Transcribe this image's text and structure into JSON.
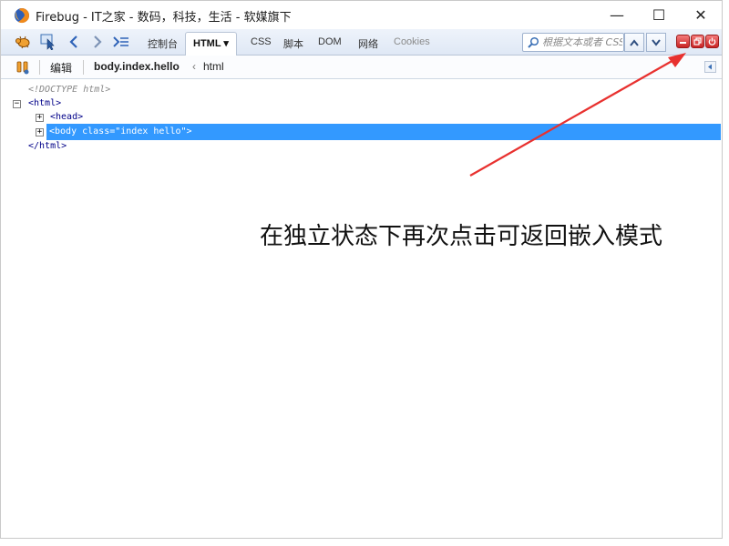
{
  "window": {
    "title": "Firebug - IT之家 - 数码，科技，生活 - 软媒旗下",
    "minimize_glyph": "—",
    "maximize_glyph": "☐",
    "close_glyph": "✕"
  },
  "tabs": [
    {
      "label": "控制台",
      "active": false,
      "disabled": false
    },
    {
      "label": "HTML ▾",
      "active": true,
      "disabled": false
    },
    {
      "label": "CSS",
      "active": false,
      "disabled": false
    },
    {
      "label": "脚本",
      "active": false,
      "disabled": false
    },
    {
      "label": "DOM",
      "active": false,
      "disabled": false
    },
    {
      "label": "网络",
      "active": false,
      "disabled": false
    },
    {
      "label": "Cookies",
      "active": false,
      "disabled": true
    }
  ],
  "search": {
    "placeholder": "根据文本或者 CSS"
  },
  "subbar": {
    "edit_label": "编辑",
    "breadcrumb_current": "body.index.hello",
    "breadcrumb_sep": "‹",
    "breadcrumb_parent": "html"
  },
  "tree": {
    "doctype": "<!DOCTYPE html>",
    "html_open": "<html>",
    "head": "<head>",
    "body": "<body class=\"index hello\">",
    "html_close": "</html>",
    "collapse_glyph": "−",
    "expand_glyph": "+"
  },
  "annotation": "在独立状态下再次点击可返回嵌入模式",
  "colors": {
    "selection": "#3399ff",
    "arrow": "#e8312f",
    "close_buttons": "#d63a3a"
  }
}
